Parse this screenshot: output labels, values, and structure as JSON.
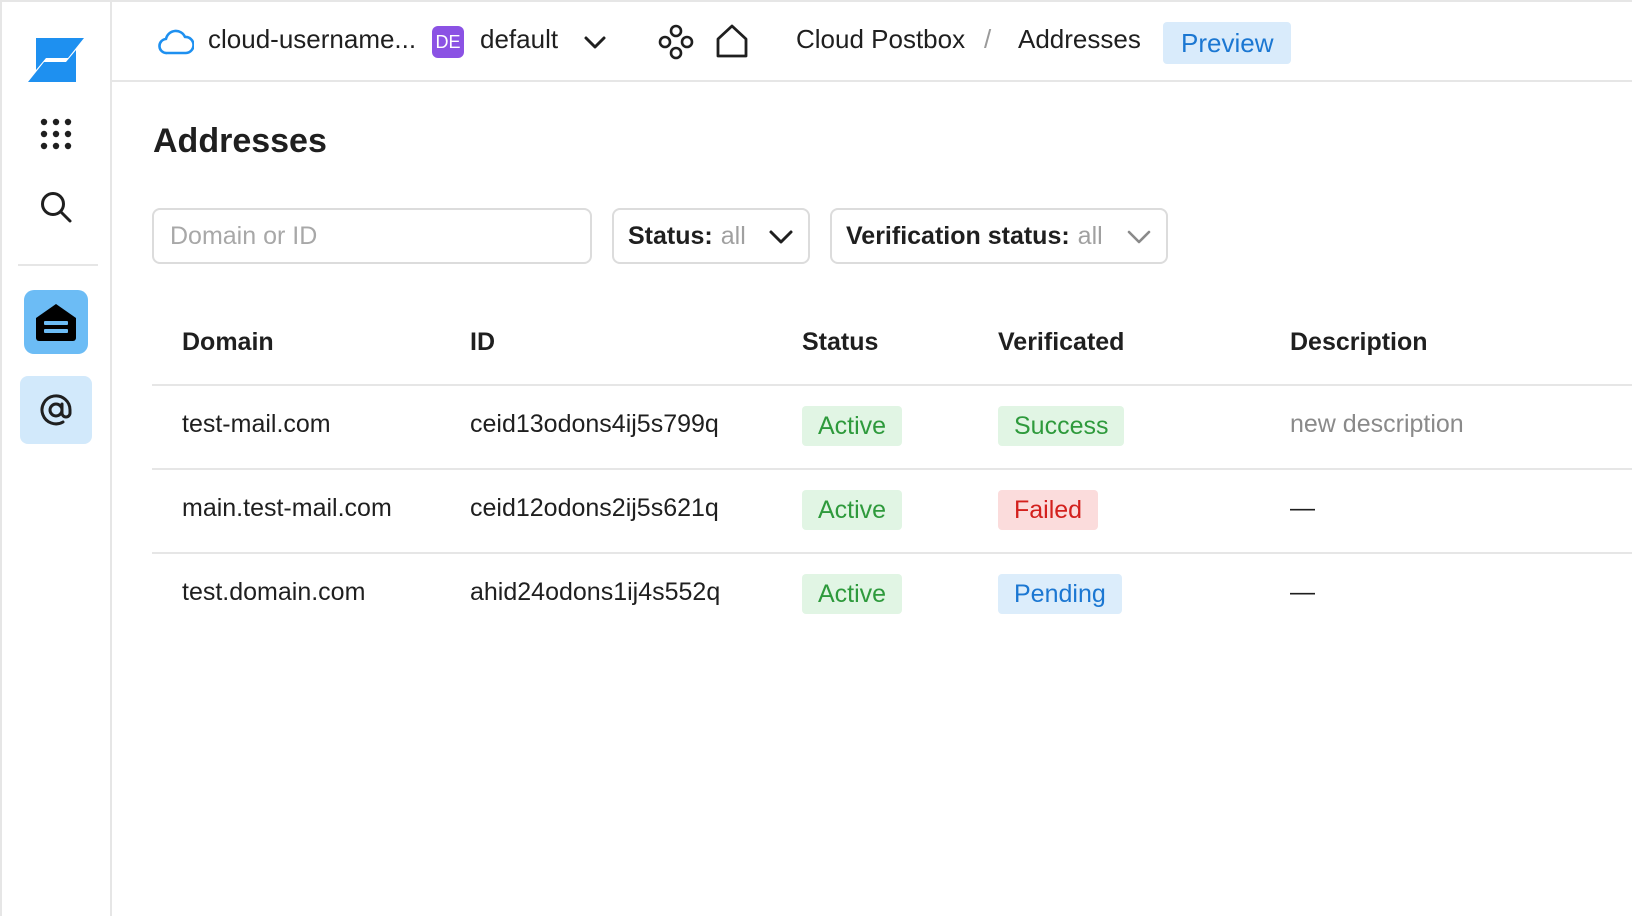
{
  "header": {
    "cloud_name": "cloud-username...",
    "folder_badge": "DE",
    "folder_name": "default",
    "breadcrumb": [
      "Cloud Postbox",
      "Addresses"
    ],
    "breadcrumb_separator": "/",
    "preview_label": "Preview"
  },
  "sidebar": {
    "items": [
      {
        "name": "logo",
        "icon": "cloud-logo-icon"
      },
      {
        "name": "all-services",
        "icon": "grid-icon"
      },
      {
        "name": "search",
        "icon": "search-icon"
      },
      {
        "name": "postbox",
        "icon": "postbox-icon",
        "active": true
      },
      {
        "name": "addresses",
        "icon": "at-icon",
        "selected": true
      }
    ]
  },
  "page": {
    "title": "Addresses"
  },
  "filters": {
    "search_placeholder": "Domain or ID",
    "search_value": "",
    "status_label": "Status:",
    "status_value": "all",
    "verification_label": "Verification status:",
    "verification_value": "all"
  },
  "table": {
    "columns": [
      "Domain",
      "ID",
      "Status",
      "Verificated",
      "Description"
    ],
    "rows": [
      {
        "domain": "test-mail.com",
        "id": "ceid13odons4ij5s799q",
        "status": "Active",
        "verification": "Success",
        "description": "new description"
      },
      {
        "domain": "main.test-mail.com",
        "id": "ceid12odons2ij5s621q",
        "status": "Active",
        "verification": "Failed",
        "description": "—"
      },
      {
        "domain": "test.domain.com",
        "id": "ahid24odons1ij4s552q",
        "status": "Active",
        "verification": "Pending",
        "description": "—"
      }
    ]
  },
  "colors": {
    "accent": "#1b77d2",
    "success": "#2e9a3c",
    "failed": "#d3201d",
    "folder_badge": "#8b52e4",
    "sidebar_active": "#6cbcf5"
  }
}
